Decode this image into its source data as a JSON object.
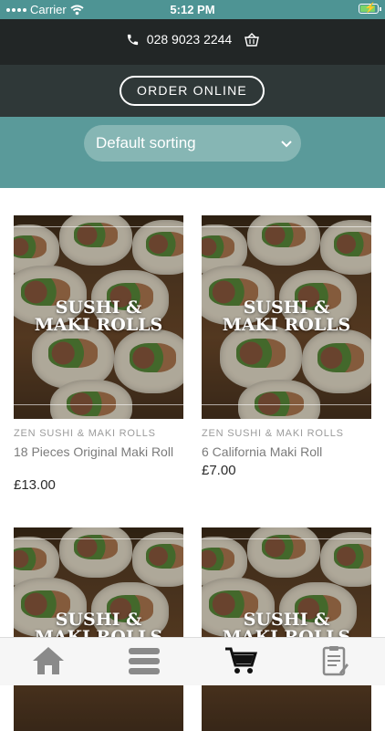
{
  "status": {
    "carrier": "Carrier",
    "time": "5:12 PM"
  },
  "header": {
    "phone": "028 9023 2244"
  },
  "order": {
    "label": "ORDER ONLINE"
  },
  "sort": {
    "label": "Default sorting"
  },
  "products": [
    {
      "image_text_1": "SUSHI &",
      "image_text_2": "MAKI ROLLS",
      "category": "ZEN SUSHI & MAKI ROLLS",
      "name": "18 Pieces Original Maki Roll",
      "price": "£13.00"
    },
    {
      "image_text_1": "SUSHI &",
      "image_text_2": "MAKI ROLLS",
      "category": "ZEN SUSHI & MAKI ROLLS",
      "name": "6 California Maki Roll",
      "price": "£7.00"
    },
    {
      "image_text_1": "SUSHI &",
      "image_text_2": "MAKI ROLLS"
    },
    {
      "image_text_1": "SUSHI &",
      "image_text_2": "MAKI ROLLS"
    }
  ],
  "tabbar": {
    "items": [
      "home-icon",
      "menu-icon",
      "cart-icon",
      "notes-icon"
    ]
  },
  "colors": {
    "accent": "#5a9a9a",
    "dark": "#222626"
  }
}
